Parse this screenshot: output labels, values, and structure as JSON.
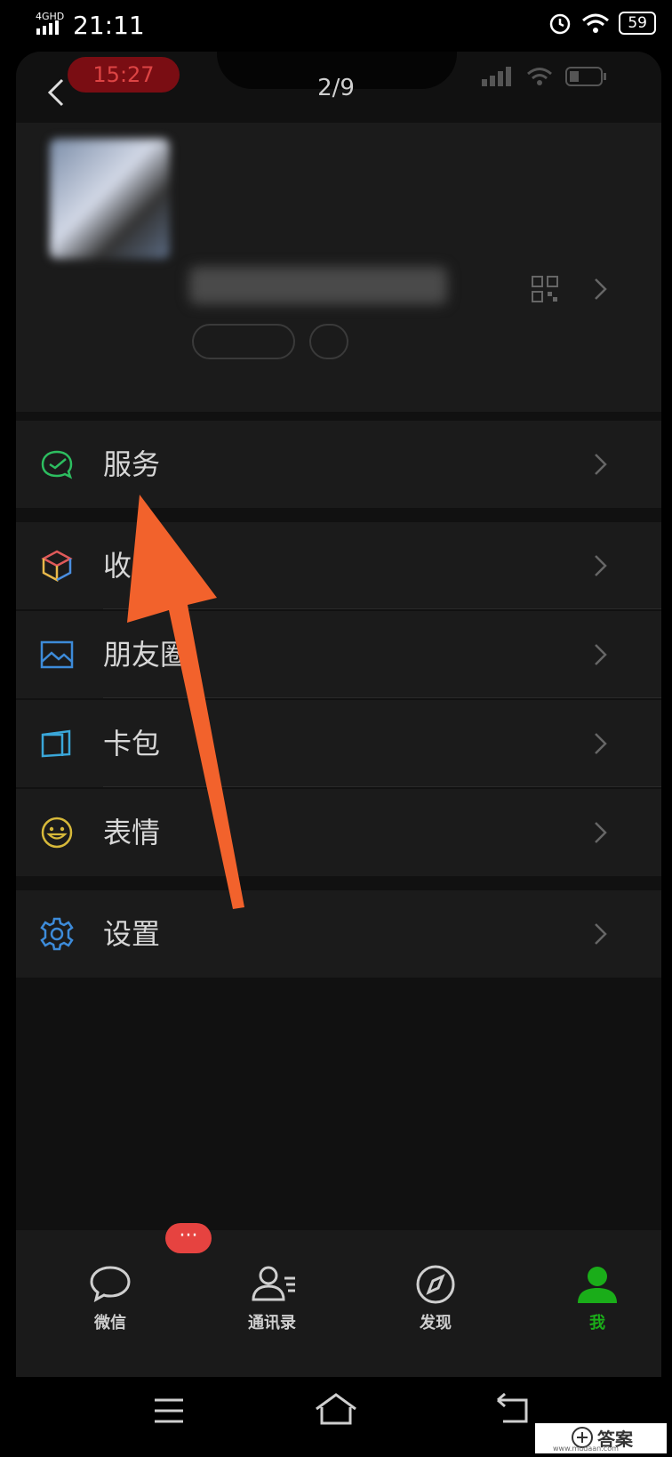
{
  "outer_status": {
    "network": "4GHD",
    "time": "21:11",
    "battery": "59"
  },
  "inner_status": {
    "time": "15:27"
  },
  "header": {
    "page_counter": "2/9"
  },
  "menu": [
    {
      "label": "服务",
      "icon": "wechat-pay-icon"
    },
    {
      "label": "收",
      "icon": "favorites-cube-icon"
    },
    {
      "label": "朋友圈",
      "icon": "moments-image-icon"
    },
    {
      "label": "卡包",
      "icon": "card-wallet-icon"
    },
    {
      "label": "表情",
      "icon": "emoji-smile-icon"
    },
    {
      "label": "设置",
      "icon": "settings-gear-icon"
    }
  ],
  "tabs": [
    {
      "label": "微信",
      "icon": "chat-bubble-icon"
    },
    {
      "label": "通讯录",
      "icon": "contacts-icon"
    },
    {
      "label": "发现",
      "icon": "compass-icon"
    },
    {
      "label": "我",
      "icon": "person-icon"
    }
  ],
  "badge": {
    "text": "···"
  },
  "watermark": {
    "text": "答案",
    "subtext": "www.mudaan.com"
  },
  "colors": {
    "accent_green": "#1aad19",
    "arrow_orange": "#f2622c",
    "badge_red": "#e64340"
  }
}
